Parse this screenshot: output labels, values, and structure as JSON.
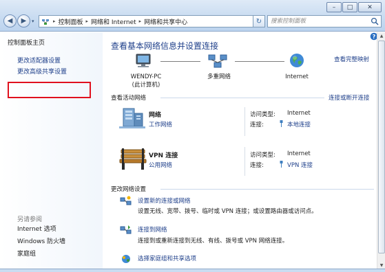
{
  "window": {
    "minimize": "–",
    "maximize": "□",
    "close": "✕"
  },
  "nav": {
    "back": "◀",
    "forward": "▶",
    "dropdown": "▾"
  },
  "address": {
    "crumbs": [
      "控制面板",
      "网络和 Internet",
      "网络和共享中心"
    ],
    "separator": "▸",
    "end": "▾"
  },
  "refresh": "↻",
  "search": {
    "placeholder": "搜索控制面板"
  },
  "left_pane": {
    "home": "控制面板主页",
    "links": [
      "更改适配器设置",
      "更改高级共享设置"
    ],
    "see_also": "另请参阅",
    "see_also_items": [
      "Internet 选项",
      "Windows 防火墙",
      "家庭组"
    ]
  },
  "main": {
    "title": "查看基本网络信息并设置连接",
    "full_map": "查看完整映射",
    "map": {
      "computer": "WENDY-PC",
      "computer_sub": "(此计算机)",
      "network": "多重网络",
      "internet": "Internet"
    },
    "active_header": "查看活动网络",
    "connect_link": "连接或断开连接",
    "networks": [
      {
        "name": "网络",
        "type": "工作网络",
        "access_label": "访问类型:",
        "access_value": "Internet",
        "conn_label": "连接:",
        "conn_value": "本地连接"
      },
      {
        "name": "VPN 连接",
        "type": "公用网络",
        "access_label": "访问类型:",
        "access_value": "Internet",
        "conn_label": "连接:",
        "conn_value": "VPN 连接"
      }
    ],
    "change_header": "更改网络设置",
    "tasks": [
      {
        "title": "设置新的连接或网络",
        "desc": "设置无线、宽带、拨号、临时或 VPN 连接；或设置路由器或访问点。"
      },
      {
        "title": "连接到网络",
        "desc": "连接到或重新连接到无线、有线、拨号或 VPN 网络连接。"
      },
      {
        "title": "选择家庭组和共享选项",
        "desc": ""
      }
    ]
  },
  "colors": {
    "link": "#1e3f8a",
    "highlight_border": "#e0101d",
    "titlebar": "#c9dcf1"
  }
}
